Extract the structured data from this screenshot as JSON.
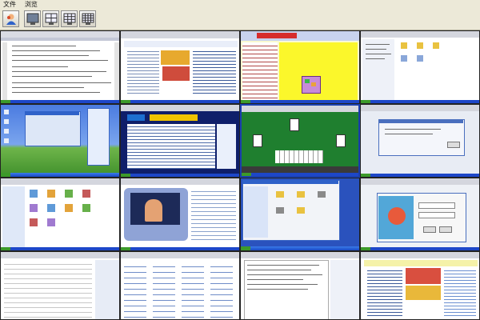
{
  "menu": {
    "items": [
      "文件",
      "浏览"
    ]
  },
  "toolbar": {
    "buttons": [
      "user-view-icon",
      "single-screen-icon",
      "four-screen-icon",
      "nine-screen-icon",
      "sixteen-screen-icon"
    ]
  },
  "grid": {
    "tiles": [
      {
        "name": "screen-1-word-document"
      },
      {
        "name": "screen-2-news-webpage"
      },
      {
        "name": "screen-3-yellow-game"
      },
      {
        "name": "screen-4-file-explorer"
      },
      {
        "name": "screen-5-desktop-chat"
      },
      {
        "name": "screen-6-portal-webpage"
      },
      {
        "name": "screen-7-card-game"
      },
      {
        "name": "screen-8-dialog-window"
      },
      {
        "name": "screen-9-control-panel"
      },
      {
        "name": "screen-10-video-player"
      },
      {
        "name": "screen-11-my-computer"
      },
      {
        "name": "screen-12-login-dialog"
      },
      {
        "name": "screen-13-spreadsheet"
      },
      {
        "name": "screen-14-icon-list"
      },
      {
        "name": "screen-15-text-document"
      },
      {
        "name": "screen-16-colorful-webpage"
      }
    ]
  }
}
